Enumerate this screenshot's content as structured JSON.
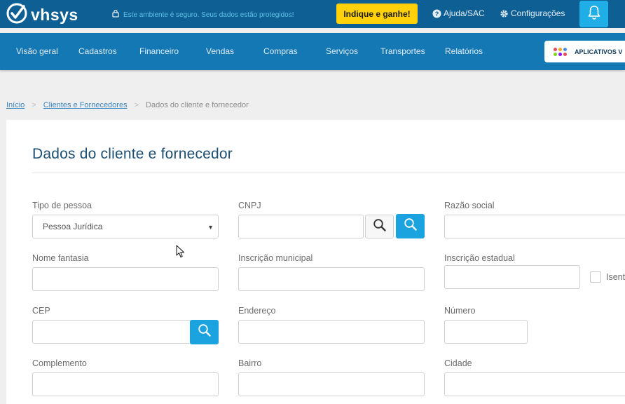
{
  "header": {
    "logo_text": "vhsys",
    "secure_text": "Este ambiente é seguro. Seus dados estão protegidos!",
    "cta_label": "Indique e ganhe!",
    "help_label": "Ajuda/SAC",
    "settings_label": "Configurações",
    "colors": {
      "topbar": "#0e5f93",
      "nav": "#1378b3",
      "cta": "#ffd10a",
      "accent": "#1aa3df"
    }
  },
  "nav": {
    "items": [
      "Visão geral",
      "Cadastros",
      "Financeiro",
      "Vendas",
      "Compras",
      "Serviços",
      "Transportes",
      "Relatórios"
    ],
    "apps_label": "APLICATIVOS V"
  },
  "breadcrumb": {
    "home": "Início",
    "parent": "Clientes e Fornecedores",
    "current": "Dados do cliente e fornecedor",
    "separator": ">"
  },
  "form": {
    "title": "Dados do cliente e fornecedor",
    "labels": {
      "tipo_pessoa": "Tipo de pessoa",
      "cnpj": "CNPJ",
      "razao_social": "Razão social",
      "nome_fantasia": "Nome fantasia",
      "inscricao_municipal": "Inscrição municipal",
      "inscricao_estadual": "Inscrição estadual",
      "isento": "Isent",
      "cep": "CEP",
      "endereco": "Endereço",
      "numero": "Número",
      "complemento": "Complemento",
      "bairro": "Bairro",
      "cidade": "Cidade"
    },
    "tipo_pessoa_value": "Pessoa Jurídica",
    "values": {
      "cnpj": "",
      "razao_social": "",
      "nome_fantasia": "",
      "inscricao_municipal": "",
      "inscricao_estadual": "",
      "cep": "",
      "endereco": "",
      "numero": "",
      "complemento": "",
      "bairro": "",
      "cidade": ""
    }
  }
}
